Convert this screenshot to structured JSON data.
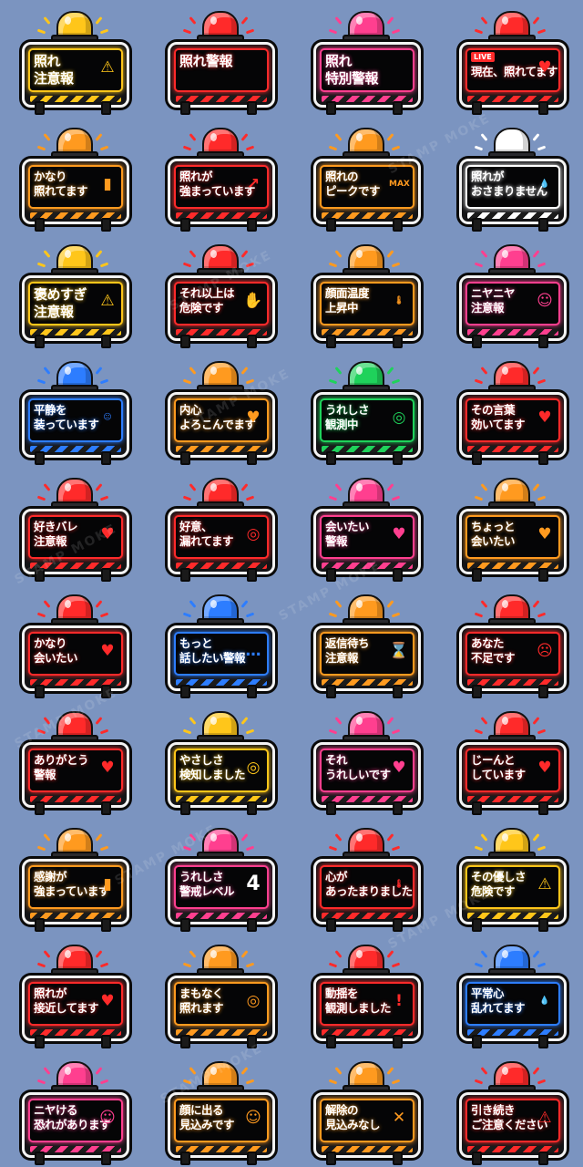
{
  "watermark": "STAMP MOKE",
  "colors": {
    "red": "#ff2a2a",
    "orange": "#ff9a1f",
    "yellow": "#ffc61a",
    "pink": "#ff3f8f",
    "blue": "#2d7dff",
    "green": "#1fd25b",
    "white": "#ffffff"
  },
  "stickers": [
    {
      "label": "照れ\n注意報",
      "color": "yellow",
      "deco": "⚠",
      "big": true
    },
    {
      "label": "照れ警報",
      "color": "red",
      "deco": "",
      "big": true
    },
    {
      "label": "照れ\n特別警報",
      "color": "pink",
      "deco": "",
      "big": true
    },
    {
      "label": "現在、照れてます",
      "color": "red",
      "deco": "♥",
      "badge": "LIVE"
    },
    {
      "label": "かなり\n照れてます",
      "color": "orange",
      "deco": "▮"
    },
    {
      "label": "照れが\n強まっています",
      "color": "red",
      "deco": "↗"
    },
    {
      "label": "照れの\nピークです",
      "color": "orange",
      "deco": "MAX"
    },
    {
      "label": "照れが\nおさまりません",
      "color": "white",
      "deco": "💧"
    },
    {
      "label": "褒めすぎ\n注意報",
      "color": "yellow",
      "deco": "⚠",
      "big": true
    },
    {
      "label": "それ以上は\n危険です",
      "color": "red",
      "deco": "✋"
    },
    {
      "label": "顔面温度\n上昇中",
      "color": "orange",
      "deco": "🌡"
    },
    {
      "label": "ニヤニヤ\n注意報",
      "color": "pink",
      "deco": "☺"
    },
    {
      "label": "平静を\n装っています",
      "color": "blue",
      "deco": "😐"
    },
    {
      "label": "内心\nよろこんでます",
      "color": "orange",
      "deco": "♥"
    },
    {
      "label": "うれしさ\n観測中",
      "color": "green",
      "deco": "◎"
    },
    {
      "label": "その言葉\n効いてます",
      "color": "red",
      "deco": "♥"
    },
    {
      "label": "好きバレ\n注意報",
      "color": "red",
      "deco": "♥"
    },
    {
      "label": "好意、\n漏れてます",
      "color": "red",
      "deco": "◎"
    },
    {
      "label": "会いたい\n警報",
      "color": "pink",
      "deco": "♥"
    },
    {
      "label": "ちょっと\n会いたい",
      "color": "orange",
      "deco": "♥"
    },
    {
      "label": "かなり\n会いたい",
      "color": "red",
      "deco": "♥"
    },
    {
      "label": "もっと\n話したい警報",
      "color": "blue",
      "deco": "…"
    },
    {
      "label": "返信待ち\n注意報",
      "color": "orange",
      "deco": "⌛"
    },
    {
      "label": "あなた\n不足です",
      "color": "red",
      "deco": "☹"
    },
    {
      "label": "ありがとう\n警報",
      "color": "red",
      "deco": "♥"
    },
    {
      "label": "やさしさ\n検知しました",
      "color": "yellow",
      "deco": "◎"
    },
    {
      "label": "それ\nうれしいです",
      "color": "pink",
      "deco": "♥"
    },
    {
      "label": "じーんと\nしています",
      "color": "red",
      "deco": "♥"
    },
    {
      "label": "感謝が\n強まっています",
      "color": "orange",
      "deco": "▮"
    },
    {
      "label": "うれしさ\n警戒レベル",
      "color": "pink",
      "deco": "4"
    },
    {
      "label": "心が\nあったまりました",
      "color": "red",
      "deco": "🌡"
    },
    {
      "label": "その優しさ\n危険です",
      "color": "yellow",
      "deco": "⚠"
    },
    {
      "label": "照れが\n接近してます",
      "color": "red",
      "deco": "♥"
    },
    {
      "label": "まもなく\n照れます",
      "color": "orange",
      "deco": "◎"
    },
    {
      "label": "動揺を\n観測しました",
      "color": "red",
      "deco": "!"
    },
    {
      "label": "平常心\n乱れてます",
      "color": "blue",
      "deco": "💧"
    },
    {
      "label": "ニヤける\n恐れがあります",
      "color": "pink",
      "deco": "☺"
    },
    {
      "label": "顔に出る\n見込みです",
      "color": "orange",
      "deco": "☺"
    },
    {
      "label": "解除の\n見込みなし",
      "color": "orange",
      "deco": "✕"
    },
    {
      "label": "引き続き\nご注意ください",
      "color": "red",
      "deco": "⚠"
    }
  ]
}
